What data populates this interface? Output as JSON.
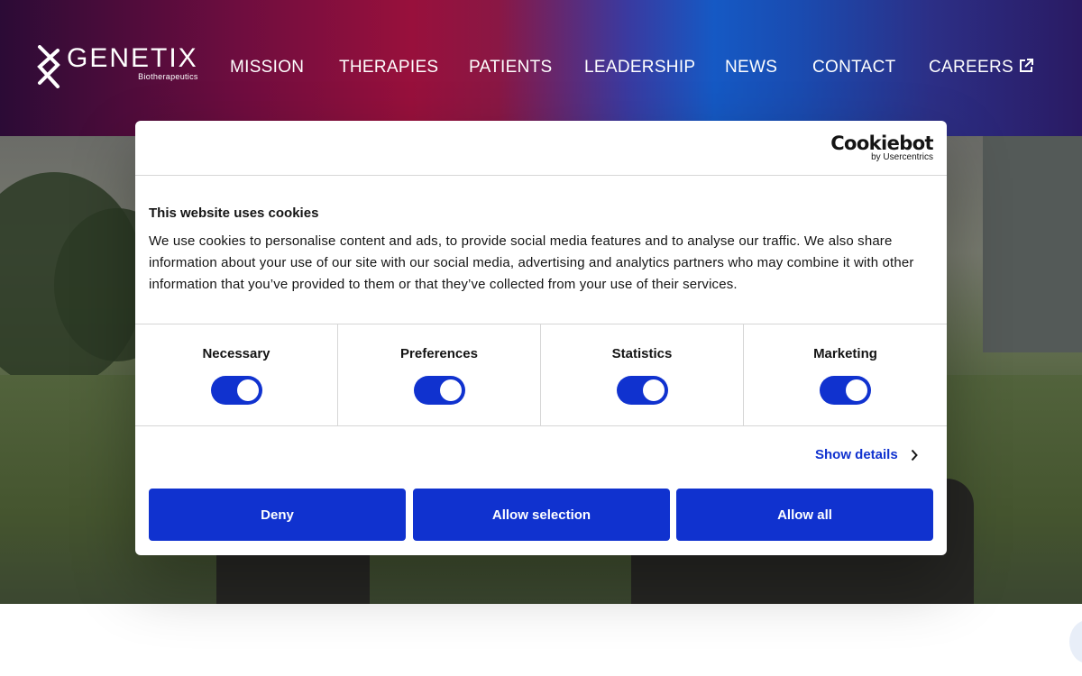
{
  "header": {
    "logo": {
      "name": "GENETIX",
      "tagline": "Biotherapeutics"
    },
    "nav": [
      {
        "label": "MISSION"
      },
      {
        "label": "THERAPIES"
      },
      {
        "label": "PATIENTS"
      },
      {
        "label": "LEADERSHIP"
      },
      {
        "label": "NEWS"
      },
      {
        "label": "CONTACT"
      },
      {
        "label": "CAREERS",
        "icon": "external-link-icon"
      }
    ]
  },
  "cookie_dialog": {
    "brand": {
      "name": "Cookiebot",
      "sub": "by Usercentrics"
    },
    "title": "This website uses cookies",
    "body": "We use cookies to personalise content and ads, to provide social media features and to analyse our traffic. We also share information about your use of our site with our social media, advertising and analytics partners who may combine it with other information that you’ve provided to them or that they’ve collected from your use of their services.",
    "consents": [
      {
        "label": "Necessary",
        "enabled": true
      },
      {
        "label": "Preferences",
        "enabled": true
      },
      {
        "label": "Statistics",
        "enabled": true
      },
      {
        "label": "Marketing",
        "enabled": true
      }
    ],
    "show_details": "Show details",
    "buttons": {
      "deny": "Deny",
      "allow_selection": "Allow selection",
      "allow_all": "Allow all"
    },
    "accent_color": "#1032cf"
  }
}
